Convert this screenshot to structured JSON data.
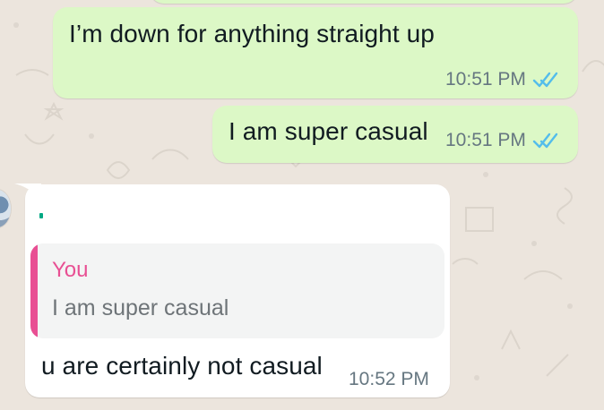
{
  "conversation": {
    "messages": [
      {
        "direction": "outgoing",
        "text": "I’m down for anything straight up",
        "time": "10:51 PM",
        "status": "read-double-check"
      },
      {
        "direction": "outgoing",
        "text": "I am super casual",
        "time": "10:51 PM",
        "status": "read-double-check"
      },
      {
        "direction": "incoming",
        "reply_to": {
          "author": "You",
          "text": "I am super casual"
        },
        "text": "u are certainly not casual",
        "time": "10:52 PM"
      }
    ]
  },
  "colors": {
    "chat_background": "#ece5dd",
    "outgoing_bubble": "#dcf8c6",
    "incoming_bubble": "#ffffff",
    "read_ticks": "#53bdeb",
    "quote_accent": "#e84f93",
    "meta_text": "#667781"
  },
  "icons": {
    "read_receipt": "double-check-icon",
    "avatar": "contact-avatar"
  }
}
